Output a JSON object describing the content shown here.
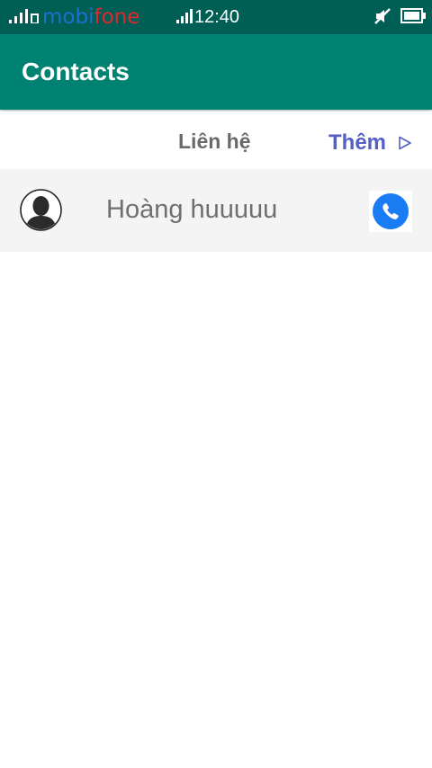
{
  "status_bar": {
    "carrier_part1": "mobi",
    "carrier_part2": "fone",
    "time": "12:40",
    "icons": [
      "signal-icon",
      "signal-icon",
      "mute-icon",
      "battery-icon"
    ]
  },
  "app_bar": {
    "title": "Contacts"
  },
  "tabs": {
    "contacts_label": "Liên hệ",
    "more_label": "Thêm"
  },
  "contacts": [
    {
      "name": "Hoàng huuuuu",
      "avatar_icon": "person-avatar-icon",
      "action_icon": "phone-icon"
    }
  ],
  "colors": {
    "status_bar": "#005f55",
    "app_bar": "#008272",
    "more_link": "#5560c4",
    "call_button": "#1a7cf2",
    "row_background": "#f4f4f4"
  }
}
